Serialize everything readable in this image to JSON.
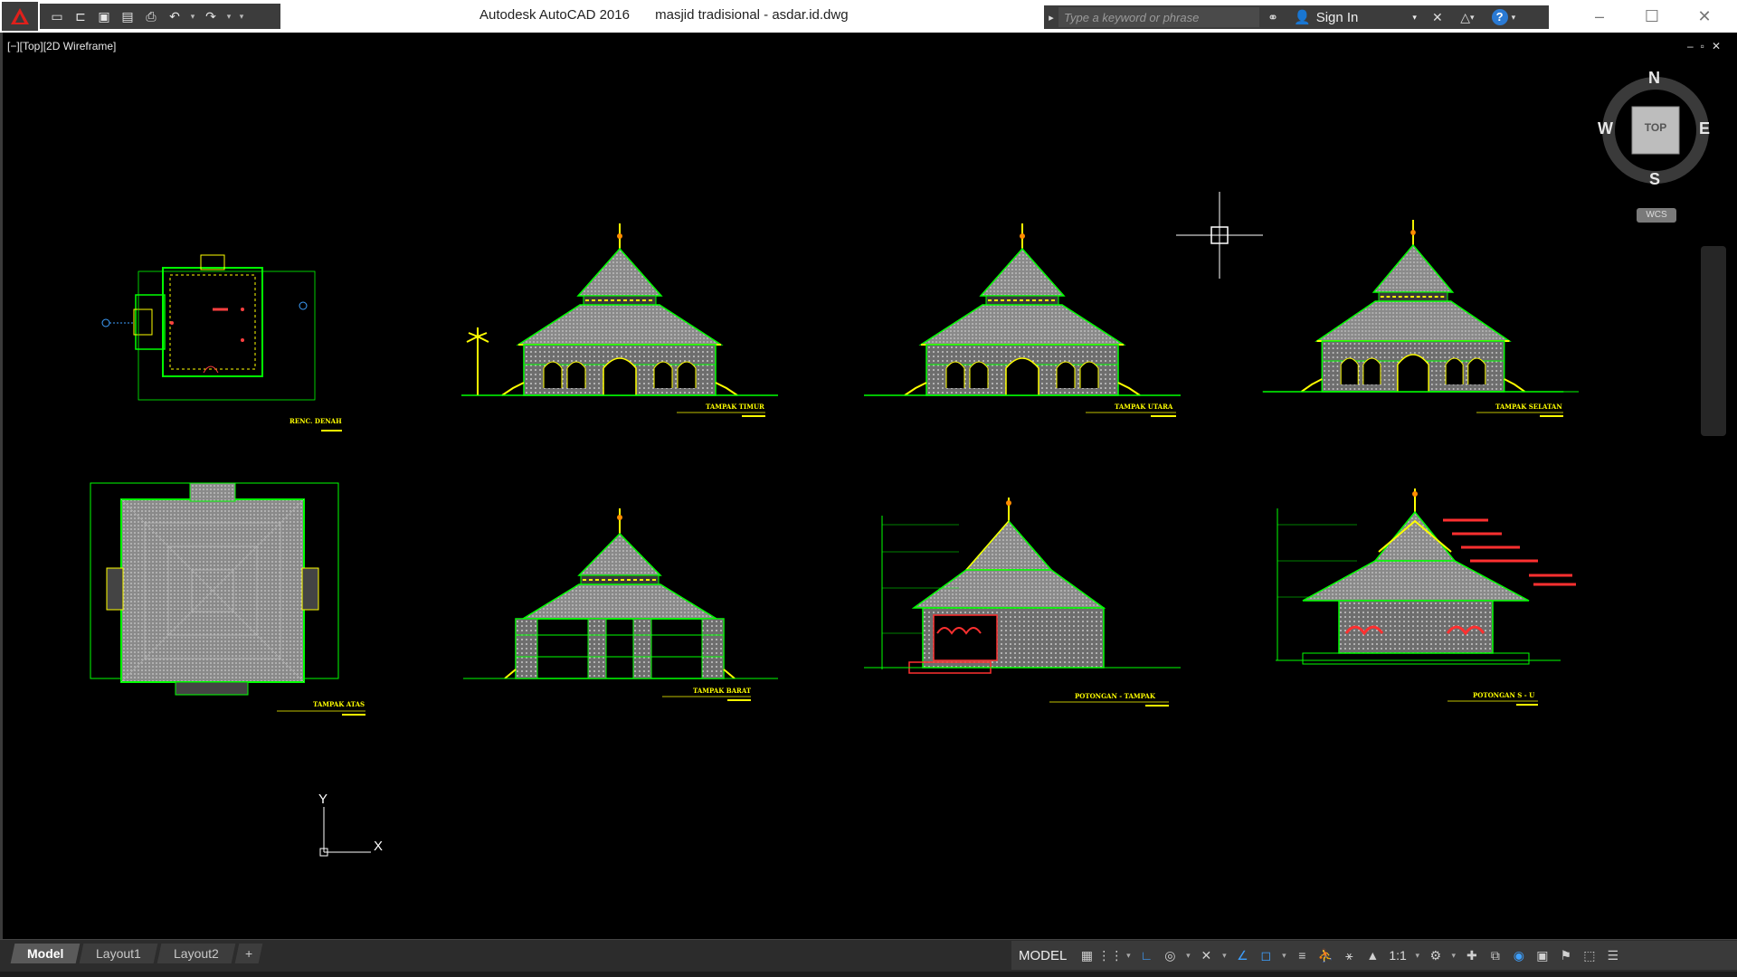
{
  "titlebar": {
    "app_name": "Autodesk AutoCAD 2016",
    "file_name": "masjid tradisional - asdar.id.dwg",
    "search_placeholder": "Type a keyword or phrase",
    "sign_in": "Sign In",
    "help": "?"
  },
  "viewport": {
    "label": "[−][Top][2D Wireframe]",
    "controls": [
      "–",
      "▫",
      "✕"
    ]
  },
  "viewcube": {
    "north": "N",
    "south": "S",
    "east": "E",
    "west": "W",
    "face": "TOP",
    "ucs": "WCS"
  },
  "drawing": {
    "labels": {
      "plan": "RENC. DENAH",
      "east": "TAMPAK TIMUR",
      "north": "TAMPAK UTARA",
      "south": "TAMPAK SELATAN",
      "top": "TAMPAK ATAS",
      "west": "TAMPAK BARAT",
      "section1": "POTONGAN - TAMPAK",
      "section2": "POTONGAN S - U"
    },
    "ucs": {
      "x": "X",
      "y": "Y"
    }
  },
  "status": {
    "tabs": [
      "Model",
      "Layout1",
      "Layout2"
    ],
    "active_tab": "Model",
    "add_tab": "+",
    "model": "MODEL",
    "scale": "1:1"
  },
  "colors": {
    "accent": "#3ea0ff",
    "linework": "#00ff00",
    "text": "#ffff00",
    "roof": "#9a9a9a"
  }
}
